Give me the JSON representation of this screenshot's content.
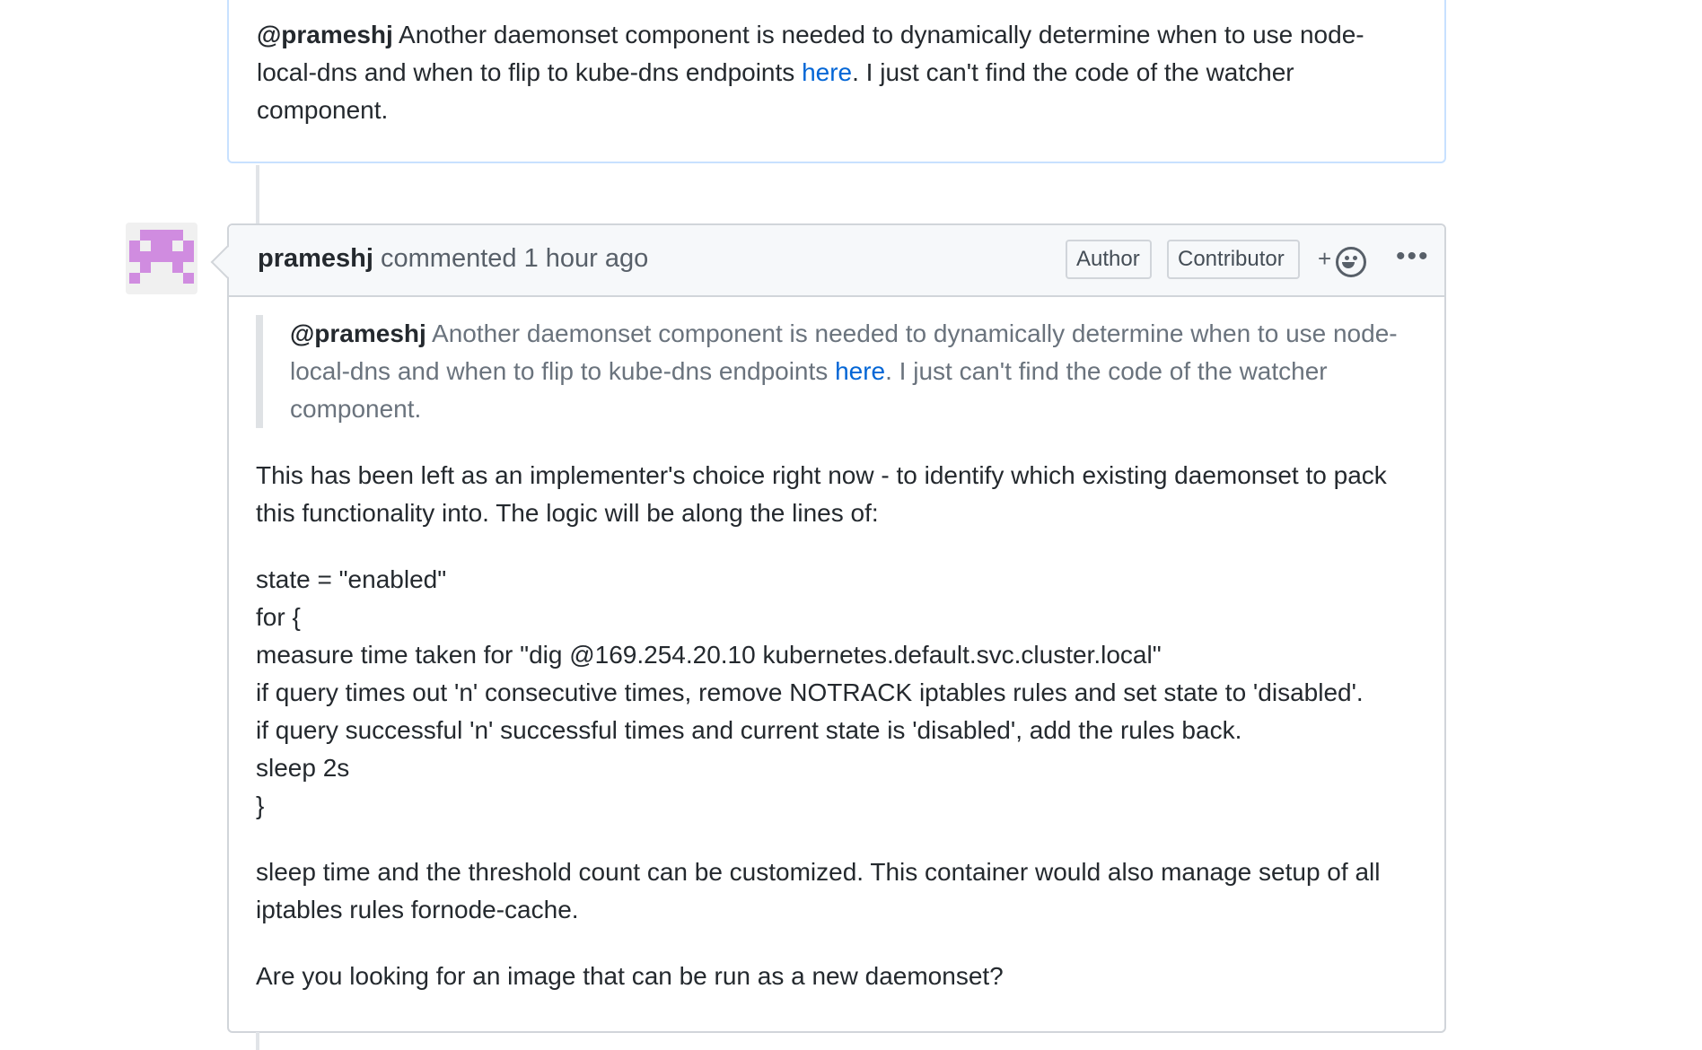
{
  "previous_comment": {
    "mention": "@prameshj",
    "text_before_link": " Another daemonset component is needed to dynamically determine when to use node-local-dns and when to flip to kube-dns endpoints ",
    "link_text": "here",
    "text_after_link": ". I just can't find the code of the watcher component."
  },
  "comment": {
    "author": "prameshj",
    "action": " commented ",
    "time": "1 hour ago",
    "badges": [
      "Author",
      "Contributor"
    ],
    "reaction_plus": "+",
    "menu_icon": "kebab-horizontal-icon",
    "quote": {
      "mention": "@prameshj",
      "text_before_link": " Another daemonset component is needed to dynamically determine when to use node-local-dns and when to flip to kube-dns endpoints ",
      "link_text": "here",
      "text_after_link": ". I just can't find the code of the watcher component."
    },
    "paragraph1": "This has been left as an implementer's choice right now - to identify which existing daemonset to pack this functionality into. The logic will be along the lines of:",
    "code_lines": [
      "state = \"enabled\"",
      "for {",
      "measure time taken for \"dig @169.254.20.10 kubernetes.default.svc.cluster.local\"",
      "if query times out 'n' consecutive times, remove NOTRACK iptables rules and set state to 'disabled'.",
      "if query successful 'n' successful times and current state is 'disabled', add the rules back.",
      "sleep 2s",
      "}"
    ],
    "paragraph2": "sleep time and the threshold count can be customized. This container would also manage setup of all iptables rules fornode-cache.",
    "paragraph3": "Are you looking for an image that can be run as a new daemonset?"
  },
  "colors": {
    "link": "#0366d6",
    "avatar": "#d08ce0",
    "border": "#d1d5da",
    "prev_border": "#c8e1ff"
  }
}
